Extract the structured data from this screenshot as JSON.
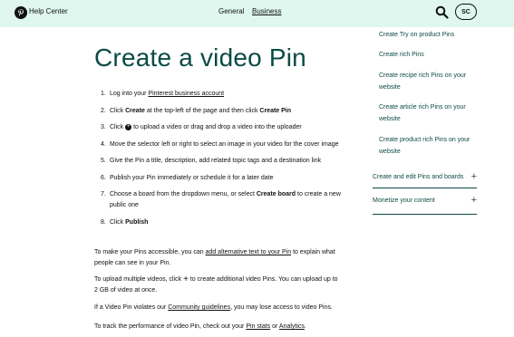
{
  "header": {
    "brand": "Help Center",
    "nav": [
      "General",
      "Business"
    ],
    "avatar": "SC",
    "logo_icon": "pinterest-logo-icon",
    "search_icon": "search-icon"
  },
  "article": {
    "title": "Create a video Pin",
    "steps": [
      {
        "num": "1.",
        "pre": "Log into your ",
        "link": "Pinterest business account"
      },
      {
        "num": "2.",
        "pre": "Click ",
        "b1": "Create",
        "mid": " at the top-left of the page and then click ",
        "b2": "Create Pin"
      },
      {
        "num": "3.",
        "pre": "Click ",
        "post": " to upload a video or drag and drop a video into the uploader"
      },
      {
        "num": "4.",
        "text": "Move the selector left or right to select an image in your video for the cover image"
      },
      {
        "num": "5.",
        "text": "Give the Pin a title, description, add related topic tags and a destination link"
      },
      {
        "num": "6.",
        "text": "Publish your Pin immediately or schedule it for a later date"
      },
      {
        "num": "7.",
        "pre": "Choose a board from the dropdown menu, or select ",
        "b1": "Create board",
        "post": " to create a new public one"
      },
      {
        "num": "8.",
        "pre": "Click ",
        "b1": "Publish"
      }
    ],
    "p1": {
      "pre": "To make your Pins accessible, you can ",
      "link": "add alternative text to your Pin",
      "post": " to explain what people can see in your Pin."
    },
    "p2": {
      "pre": "To upload multiple videos, click ",
      "post": " to create additional video Pins. You can upload up to 2 GB of video at once."
    },
    "p3": {
      "pre": "If a Video Pin violates our ",
      "link": "Community guidelines",
      "post": ", you may lose access to video Pins."
    },
    "p4": {
      "pre": "To track the performance of video Pin, check out your ",
      "link1": "Pin stats",
      "mid": " or ",
      "link2": "Analytics",
      "post": "."
    }
  },
  "sidebar": {
    "items": [
      "Create Try on product Pins",
      "Create rich Pins",
      "Create recipe rich Pins on your website",
      "Create article rich Pins on your website",
      "Create product rich Pins on your website"
    ],
    "sections": [
      "Create and edit Pins and boards",
      "Monetize your content"
    ]
  },
  "colors": {
    "header_bg": "#dff7ee",
    "title": "#0b4b45"
  }
}
